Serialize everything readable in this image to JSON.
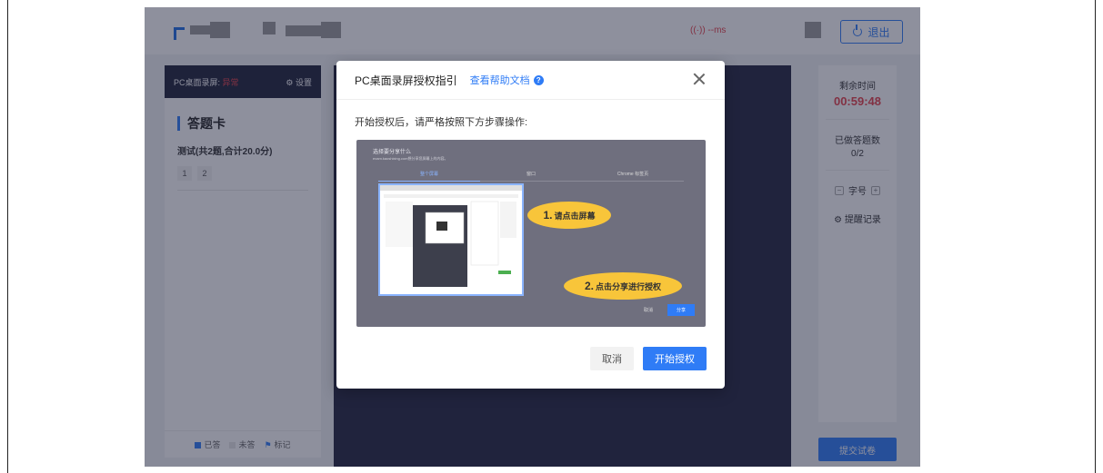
{
  "topbar": {
    "ping": "((·)) --ms",
    "exit_label": "退出"
  },
  "left": {
    "header_label": "PC桌面录屏:",
    "header_status": "异常",
    "settings_label": "⚙ 设置",
    "card_title": "答题卡",
    "exam_subtitle": "测试(共2题,合计20.0分)",
    "question_numbers": [
      "1",
      "2"
    ],
    "legend": {
      "answered": "已答",
      "unanswered": "未答",
      "marked": "标记"
    }
  },
  "right": {
    "remaining_label": "剩余时间",
    "remaining_time": "00:59:48",
    "done_label": "已做答题数",
    "done_count": "0/2",
    "font_label": "字号",
    "remind_label": "提醒记录",
    "submit_label": "提交试卷"
  },
  "dialog": {
    "title": "PC桌面录屏授权指引",
    "help_link": "查看帮助文档",
    "description": "开始授权后，请严格按照下方步骤操作:",
    "illustration": {
      "heading": "选择要分享什么",
      "subheading": "exam.kaoshixing.com想分享您屏幕上的内容。",
      "tabs": [
        "整个屏幕",
        "窗口",
        "Chrome 标签页"
      ],
      "step1_num": "1.",
      "step1_text": "请点击屏幕",
      "step2_num": "2.",
      "step2_text": "点击分享进行授权",
      "cancel": "取消",
      "share": "分享"
    },
    "cancel_label": "取消",
    "start_label": "开始授权"
  },
  "colors": {
    "accent": "#2f7cf6",
    "danger": "#e7414a",
    "dark": "#23253f",
    "bubble": "#f8c53a"
  }
}
